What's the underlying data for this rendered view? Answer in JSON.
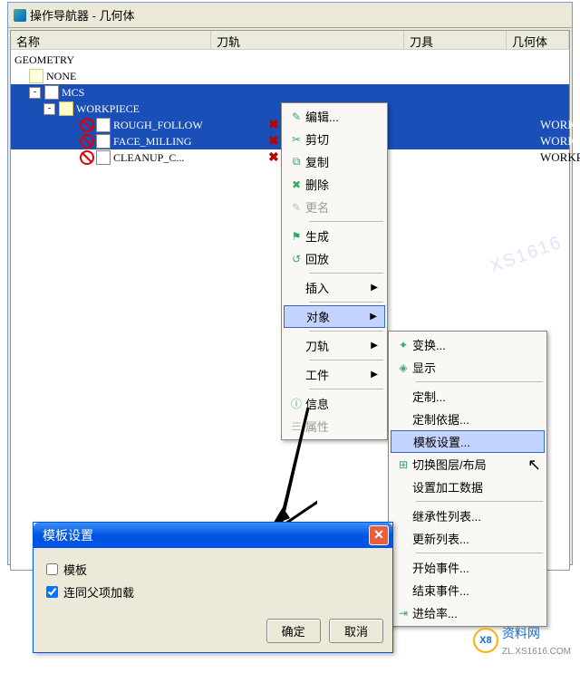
{
  "window": {
    "title": "操作导航器 - 几何体"
  },
  "columns": {
    "name": "名称",
    "toolpath": "刀轨",
    "tool": "刀具",
    "geometry": "几何体"
  },
  "tree": {
    "root": "GEOMETRY",
    "none": "NONE",
    "mcs": "MCS",
    "workpiece": "WORKPIECE",
    "ops": [
      {
        "name": "ROUGH_FOLLOW",
        "geom": "WORKPIECE"
      },
      {
        "name": "FACE_MILLING",
        "geom": "WORKPIECE"
      },
      {
        "name": "CLEANUP_C...",
        "geom": "WORKPIECE"
      }
    ]
  },
  "menu1": {
    "edit": "编辑...",
    "cut": "剪切",
    "copy": "复制",
    "delete": "删除",
    "rename": "更名",
    "generate": "生成",
    "replay": "回放",
    "insert": "插入",
    "object": "对象",
    "toolpath": "刀轨",
    "workpiece": "工件",
    "info": "信息",
    "properties": "属性"
  },
  "menu2": {
    "transform": "变换...",
    "display": "显示",
    "customize": "定制...",
    "customize_based": "定制依据...",
    "template_settings": "模板设置...",
    "switch_layer": "切换图层/布局",
    "set_machining_data": "设置加工数据",
    "inherit_list": "继承性列表...",
    "update_list": "更新列表...",
    "start_event": "开始事件...",
    "end_event": "结束事件...",
    "gouge_check": "进给率..."
  },
  "dialog": {
    "title": "模板设置",
    "chk_template": "模板",
    "chk_load": "连同父项加载",
    "ok": "确定",
    "cancel": "取消"
  },
  "watermark": {
    "site": "资料网",
    "url": "ZL.XS1616.COM",
    "ghost": "XS1616"
  }
}
